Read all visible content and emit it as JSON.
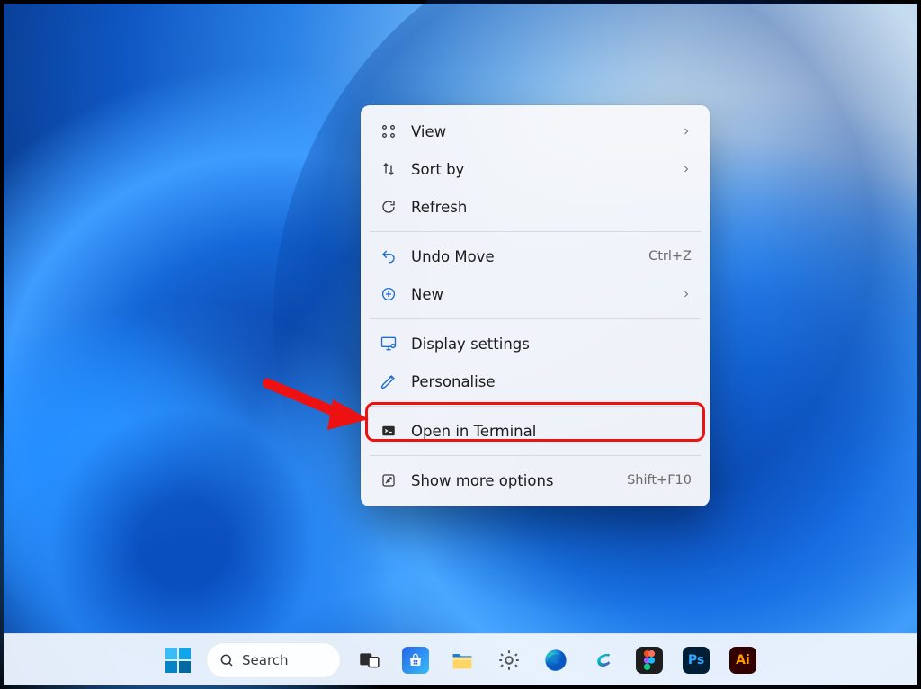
{
  "context_menu": {
    "items": [
      {
        "icon": "grid-icon",
        "label": "View",
        "has_submenu": true
      },
      {
        "icon": "sort-icon",
        "label": "Sort by",
        "has_submenu": true
      },
      {
        "icon": "refresh-icon",
        "label": "Refresh"
      },
      {
        "sep": true
      },
      {
        "icon": "undo-icon",
        "label": "Undo Move",
        "shortcut": "Ctrl+Z"
      },
      {
        "icon": "new-icon",
        "label": "New",
        "has_submenu": true
      },
      {
        "sep": true
      },
      {
        "icon": "display-icon",
        "label": "Display settings"
      },
      {
        "icon": "personalise-icon",
        "label": "Personalise",
        "highlighted": true
      },
      {
        "sep": true
      },
      {
        "icon": "terminal-icon",
        "label": "Open in Terminal"
      },
      {
        "sep": true
      },
      {
        "icon": "more-icon",
        "label": "Show more options",
        "shortcut": "Shift+F10"
      }
    ]
  },
  "taskbar": {
    "search_label": "Search",
    "apps": [
      {
        "name": "start",
        "title": "Start"
      },
      {
        "name": "search",
        "title": "Search"
      },
      {
        "name": "task-view",
        "title": "Task View"
      },
      {
        "name": "microsoft-store",
        "title": "Microsoft Store"
      },
      {
        "name": "file-explorer",
        "title": "File Explorer"
      },
      {
        "name": "settings",
        "title": "Settings"
      },
      {
        "name": "edge",
        "title": "Microsoft Edge"
      },
      {
        "name": "copilot",
        "title": "Copilot"
      },
      {
        "name": "figma",
        "title": "Figma"
      },
      {
        "name": "photoshop",
        "title": "Adobe Photoshop"
      },
      {
        "name": "illustrator",
        "title": "Adobe Illustrator"
      }
    ]
  },
  "annotation": {
    "type": "arrow",
    "color": "#e11",
    "points_to": "context-item-personalise"
  }
}
